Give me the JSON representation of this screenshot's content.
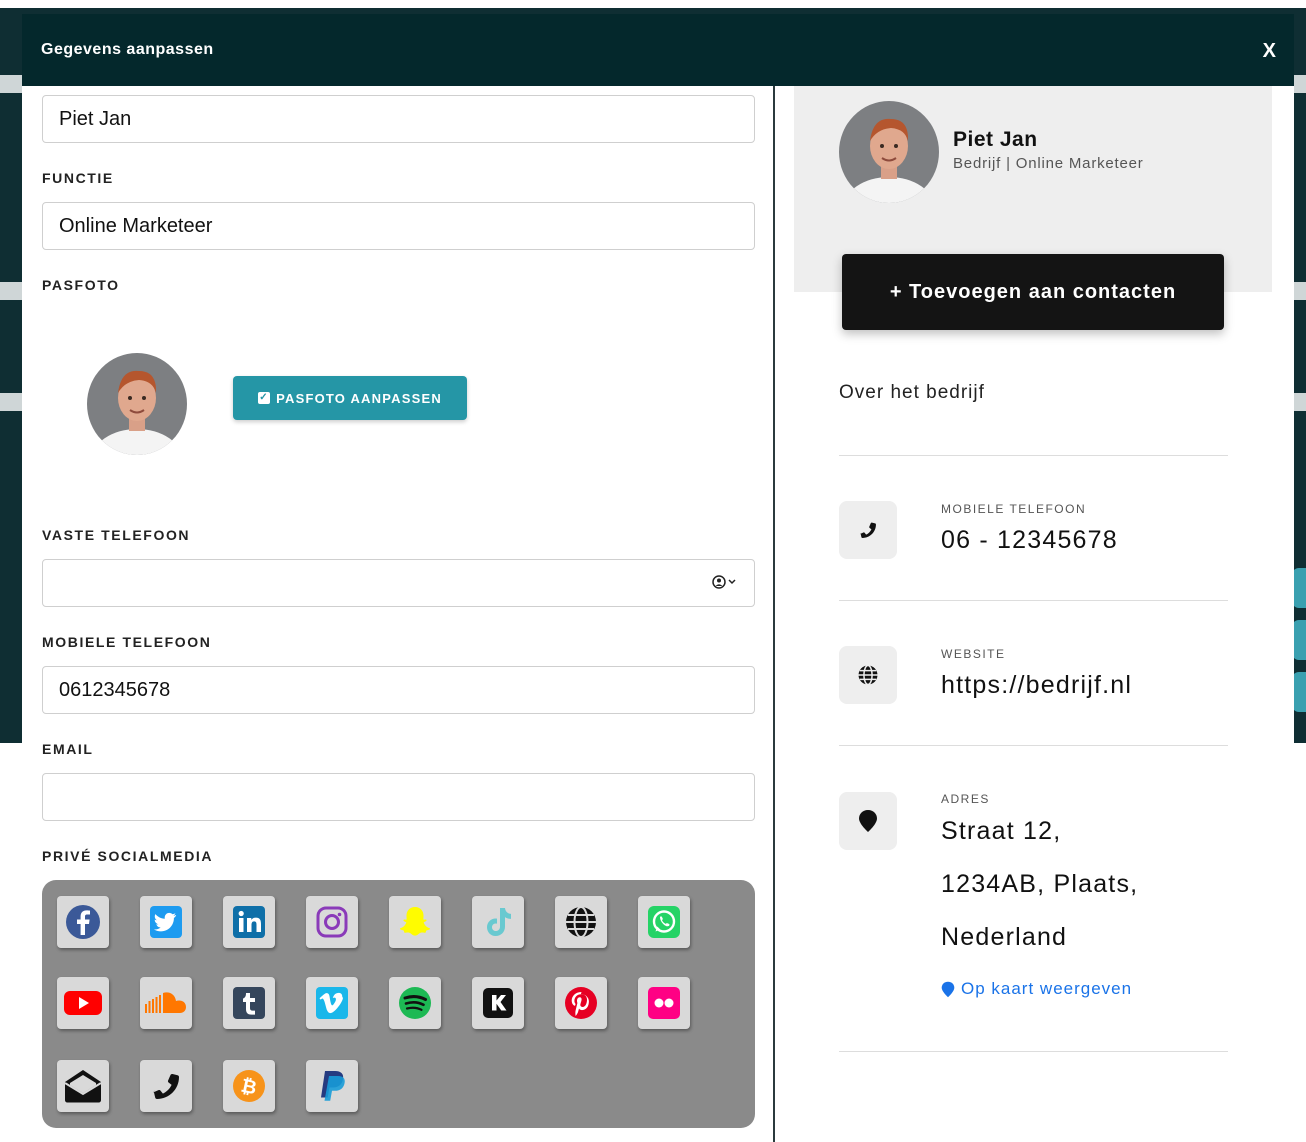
{
  "modal": {
    "title": "Gegevens aanpassen",
    "close_label": "X"
  },
  "form": {
    "name_value": "Piet Jan",
    "functie_label": "FUNCTIE",
    "functie_value": "Online Marketeer",
    "pasfoto_label": "PASFOTO",
    "pasfoto_button": "PASFOTO AANPASSEN",
    "vaste_telefoon_label": "VASTE TELEFOON",
    "vaste_telefoon_value": "",
    "mobiele_telefoon_label": "MOBIELE TELEFOON",
    "mobiele_telefoon_value": "0612345678",
    "email_label": "EMAIL",
    "email_value": "",
    "social_label": "PRIVÉ SOCIALMEDIA"
  },
  "social_icons": [
    {
      "name": "facebook",
      "color": "#3b5998"
    },
    {
      "name": "twitter",
      "color": "#1da1f2"
    },
    {
      "name": "linkedin",
      "color": "#0e76a8"
    },
    {
      "name": "instagram",
      "color": "#8a3ab9"
    },
    {
      "name": "snapchat",
      "color": "#fffc00"
    },
    {
      "name": "tiktok",
      "color": "#69c9d0"
    },
    {
      "name": "website",
      "color": "#111111"
    },
    {
      "name": "whatsapp",
      "color": "#25d366"
    },
    {
      "name": "youtube",
      "color": "#ff0000"
    },
    {
      "name": "soundcloud",
      "color": "#ff7700"
    },
    {
      "name": "tumblr",
      "color": "#35465c"
    },
    {
      "name": "vimeo",
      "color": "#1ab7ea"
    },
    {
      "name": "spotify",
      "color": "#1db954"
    },
    {
      "name": "kik",
      "color": "#111111"
    },
    {
      "name": "pinterest",
      "color": "#e60023"
    },
    {
      "name": "flickr",
      "color": "#ff0084"
    },
    {
      "name": "mail",
      "color": "#111111"
    },
    {
      "name": "phone",
      "color": "#111111"
    },
    {
      "name": "bitcoin",
      "color": "#f7931a"
    },
    {
      "name": "paypal",
      "color": "#253b80"
    }
  ],
  "preview": {
    "name": "Piet Jan",
    "subtitle": "Bedrijf | Online Marketeer",
    "add_button": "+ Toevoegen aan contacten",
    "about": "Over het bedrijf",
    "mobile_label": "MOBIELE TELEFOON",
    "mobile_value": "06 - 12345678",
    "website_label": "WEBSITE",
    "website_value": "https://bedrijf.nl",
    "address_label": "ADRES",
    "address_line1": "Straat 12,",
    "address_line2": "1234AB, Plaats,",
    "address_line3": "Nederland",
    "map_link": "Op kaart weergeven"
  }
}
